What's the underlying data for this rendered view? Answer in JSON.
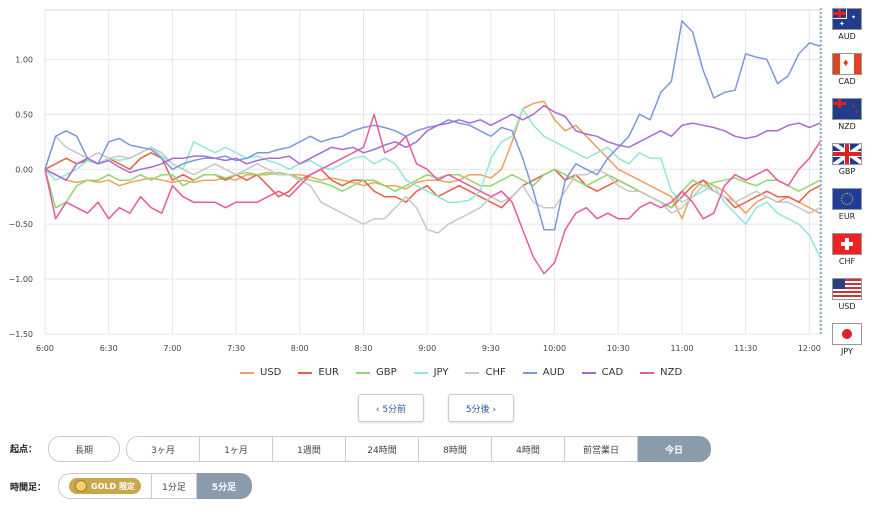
{
  "chart_data": {
    "type": "line",
    "x": [
      "6:00",
      "6:05",
      "6:10",
      "6:15",
      "6:20",
      "6:25",
      "6:30",
      "6:35",
      "6:40",
      "6:45",
      "6:50",
      "6:55",
      "7:00",
      "7:05",
      "7:10",
      "7:15",
      "7:20",
      "7:25",
      "7:30",
      "7:35",
      "7:40",
      "7:45",
      "7:50",
      "7:55",
      "8:00",
      "8:05",
      "8:10",
      "8:15",
      "8:20",
      "8:25",
      "8:30",
      "8:35",
      "8:40",
      "8:45",
      "8:50",
      "8:55",
      "9:00",
      "9:05",
      "9:10",
      "9:15",
      "9:20",
      "9:25",
      "9:30",
      "9:35",
      "9:40",
      "9:45",
      "9:50",
      "9:55",
      "10:00",
      "10:05",
      "10:10",
      "10:15",
      "10:20",
      "10:25",
      "10:30",
      "10:35",
      "10:40",
      "10:45",
      "10:50",
      "10:55",
      "11:00",
      "11:05",
      "11:10",
      "11:15",
      "11:20",
      "11:25",
      "11:30",
      "11:35",
      "11:40",
      "11:45",
      "11:50",
      "11:55",
      "12:00",
      "12:05"
    ],
    "x_ticks": [
      "6:00",
      "6:30",
      "7:00",
      "7:30",
      "8:00",
      "8:30",
      "9:00",
      "9:30",
      "10:00",
      "10:30",
      "11:00",
      "11:30",
      "12:00"
    ],
    "y_ticks": [
      "1.00",
      "0.50",
      "0.00",
      "−0.50",
      "−1.00",
      "−1.50"
    ],
    "ylim": [
      -1.5,
      1.45
    ],
    "grid": true,
    "legend_position": "bottom",
    "series": [
      {
        "name": "USD",
        "color": "#f0a060",
        "values": [
          0,
          -0.05,
          -0.1,
          -0.12,
          -0.1,
          -0.12,
          -0.1,
          -0.15,
          -0.12,
          -0.1,
          -0.08,
          -0.1,
          -0.12,
          -0.1,
          -0.12,
          -0.1,
          -0.1,
          -0.08,
          -0.1,
          -0.05,
          -0.05,
          -0.03,
          -0.05,
          -0.05,
          -0.05,
          -0.07,
          -0.1,
          -0.08,
          -0.1,
          -0.12,
          -0.15,
          -0.12,
          -0.15,
          -0.15,
          -0.18,
          -0.12,
          -0.1,
          -0.1,
          -0.12,
          -0.1,
          -0.05,
          -0.05,
          -0.08,
          0.0,
          0.25,
          0.55,
          0.6,
          0.62,
          0.45,
          0.35,
          0.4,
          0.3,
          0.2,
          0.1,
          0.0,
          -0.05,
          -0.1,
          -0.15,
          -0.2,
          -0.25,
          -0.45,
          -0.2,
          -0.1,
          -0.15,
          -0.2,
          -0.3,
          -0.4,
          -0.3,
          -0.25,
          -0.3,
          -0.25,
          -0.3,
          -0.35,
          -0.4
        ]
      },
      {
        "name": "EUR",
        "color": "#e8604c",
        "values": [
          0,
          0.05,
          0.1,
          0.05,
          0.08,
          0.05,
          0.1,
          0.05,
          0.0,
          0.1,
          0.15,
          0.1,
          -0.1,
          -0.05,
          -0.1,
          -0.05,
          -0.05,
          -0.1,
          -0.05,
          -0.1,
          -0.05,
          -0.15,
          -0.25,
          -0.2,
          -0.1,
          -0.05,
          0.0,
          -0.1,
          -0.15,
          -0.1,
          -0.1,
          -0.2,
          -0.25,
          -0.25,
          -0.3,
          -0.2,
          -0.15,
          -0.25,
          -0.2,
          -0.15,
          -0.2,
          -0.25,
          -0.3,
          -0.35,
          -0.25,
          -0.15,
          -0.1,
          -0.05,
          0.0,
          -0.1,
          -0.05,
          -0.15,
          -0.2,
          -0.15,
          -0.1,
          -0.15,
          -0.2,
          -0.25,
          -0.3,
          -0.35,
          -0.25,
          -0.15,
          -0.1,
          -0.2,
          -0.25,
          -0.35,
          -0.3,
          -0.25,
          -0.2,
          -0.25,
          -0.25,
          -0.3,
          -0.2,
          -0.15
        ]
      },
      {
        "name": "GBP",
        "color": "#90d870",
        "values": [
          0,
          -0.35,
          -0.3,
          -0.15,
          -0.1,
          -0.1,
          -0.05,
          -0.1,
          -0.1,
          -0.05,
          -0.1,
          -0.05,
          -0.05,
          -0.15,
          -0.1,
          -0.05,
          -0.05,
          -0.08,
          -0.05,
          -0.03,
          -0.05,
          -0.05,
          -0.03,
          -0.05,
          -0.08,
          -0.1,
          -0.12,
          -0.15,
          -0.2,
          -0.15,
          -0.1,
          -0.1,
          -0.15,
          -0.2,
          -0.15,
          -0.1,
          -0.05,
          -0.08,
          -0.05,
          -0.05,
          -0.1,
          -0.15,
          -0.15,
          -0.1,
          -0.05,
          -0.1,
          -0.15,
          -0.05,
          0.0,
          -0.05,
          -0.1,
          -0.15,
          -0.1,
          -0.05,
          -0.1,
          -0.15,
          -0.2,
          -0.25,
          -0.3,
          -0.35,
          -0.2,
          -0.1,
          -0.15,
          -0.12,
          -0.1,
          -0.08,
          -0.12,
          -0.15,
          -0.1,
          -0.1,
          -0.15,
          -0.2,
          -0.15,
          -0.1
        ]
      },
      {
        "name": "JPY",
        "color": "#90e8d8",
        "values": [
          0,
          -0.1,
          -0.05,
          0.0,
          0.08,
          0.05,
          0.1,
          0.08,
          0.1,
          0.15,
          0.2,
          0.12,
          0.05,
          0.0,
          0.25,
          0.2,
          0.15,
          0.2,
          0.15,
          0.1,
          0.12,
          0.08,
          0.05,
          0.0,
          0.05,
          0.08,
          0.02,
          0.0,
          0.05,
          0.1,
          0.12,
          0.05,
          0.1,
          0.05,
          -0.1,
          -0.15,
          -0.2,
          -0.25,
          -0.3,
          -0.3,
          -0.28,
          -0.2,
          0.1,
          0.25,
          0.3,
          0.55,
          0.4,
          0.3,
          0.25,
          0.2,
          0.15,
          0.1,
          0.15,
          0.2,
          0.1,
          0.05,
          0.15,
          0.1,
          0.1,
          -0.2,
          -0.3,
          -0.25,
          -0.2,
          -0.15,
          -0.3,
          -0.4,
          -0.5,
          -0.35,
          -0.3,
          -0.4,
          -0.45,
          -0.5,
          -0.6,
          -0.8
        ]
      },
      {
        "name": "CHF",
        "color": "#c8c8c8",
        "values": [
          0,
          0.3,
          0.2,
          0.15,
          0.1,
          0.15,
          0.1,
          0.12,
          0.1,
          0.15,
          0.2,
          0.15,
          0.05,
          0.0,
          -0.05,
          0.0,
          0.05,
          0.0,
          -0.05,
          0.0,
          0.05,
          0.0,
          -0.05,
          -0.05,
          -0.1,
          -0.15,
          -0.3,
          -0.35,
          -0.4,
          -0.45,
          -0.5,
          -0.45,
          -0.45,
          -0.35,
          -0.25,
          -0.35,
          -0.55,
          -0.58,
          -0.5,
          -0.45,
          -0.4,
          -0.35,
          -0.25,
          -0.3,
          -0.25,
          -0.15,
          -0.3,
          -0.35,
          -0.35,
          -0.2,
          -0.05,
          -0.05,
          0.0,
          -0.05,
          -0.15,
          -0.2,
          -0.2,
          -0.25,
          -0.3,
          -0.4,
          -0.35,
          -0.25,
          -0.15,
          -0.2,
          -0.25,
          -0.3,
          -0.25,
          -0.2,
          -0.25,
          -0.3,
          -0.3,
          -0.35,
          -0.4,
          -0.35
        ]
      },
      {
        "name": "AUD",
        "color": "#7b98dc",
        "values": [
          0,
          0.3,
          0.35,
          0.3,
          0.1,
          0.05,
          0.25,
          0.28,
          0.22,
          0.2,
          0.18,
          0.1,
          0.0,
          0.05,
          0.08,
          0.1,
          0.1,
          0.12,
          0.08,
          0.1,
          0.15,
          0.15,
          0.18,
          0.2,
          0.25,
          0.3,
          0.25,
          0.28,
          0.3,
          0.35,
          0.38,
          0.4,
          0.38,
          0.35,
          0.3,
          0.35,
          0.38,
          0.4,
          0.45,
          0.42,
          0.4,
          0.35,
          0.3,
          0.38,
          0.35,
          0.1,
          -0.2,
          -0.55,
          -0.55,
          -0.1,
          0.05,
          0.0,
          -0.05,
          0.1,
          0.2,
          0.3,
          0.5,
          0.45,
          0.7,
          0.8,
          1.35,
          1.25,
          0.9,
          0.65,
          0.7,
          0.72,
          1.05,
          1.02,
          1.0,
          0.78,
          0.85,
          1.05,
          1.15,
          1.12
        ]
      },
      {
        "name": "CAD",
        "color": "#a86cd0",
        "values": [
          0,
          -0.05,
          -0.1,
          0.05,
          0.1,
          0.05,
          0.08,
          0.02,
          -0.03,
          0.0,
          0.02,
          0.05,
          0.1,
          0.1,
          0.12,
          0.12,
          0.1,
          0.08,
          0.1,
          0.05,
          0.08,
          0.1,
          0.1,
          0.12,
          0.05,
          0.1,
          0.15,
          0.2,
          0.18,
          0.2,
          0.15,
          0.18,
          0.22,
          0.25,
          0.2,
          0.25,
          0.35,
          0.4,
          0.42,
          0.45,
          0.42,
          0.45,
          0.4,
          0.45,
          0.5,
          0.45,
          0.5,
          0.58,
          0.52,
          0.48,
          0.35,
          0.32,
          0.3,
          0.25,
          0.22,
          0.2,
          0.25,
          0.3,
          0.35,
          0.3,
          0.4,
          0.42,
          0.4,
          0.38,
          0.35,
          0.3,
          0.28,
          0.3,
          0.35,
          0.35,
          0.4,
          0.42,
          0.38,
          0.42
        ]
      },
      {
        "name": "NZD",
        "color": "#e85aa0",
        "values": [
          0,
          -0.45,
          -0.3,
          -0.35,
          -0.4,
          -0.3,
          -0.45,
          -0.35,
          -0.4,
          -0.25,
          -0.35,
          -0.4,
          -0.15,
          -0.25,
          -0.3,
          -0.3,
          -0.3,
          -0.35,
          -0.3,
          -0.3,
          -0.3,
          -0.25,
          -0.2,
          -0.25,
          -0.15,
          -0.05,
          0.0,
          0.05,
          0.1,
          0.15,
          0.2,
          0.5,
          0.15,
          0.2,
          0.3,
          0.05,
          0.0,
          -0.1,
          -0.05,
          -0.1,
          -0.15,
          -0.2,
          -0.25,
          -0.2,
          -0.3,
          -0.55,
          -0.8,
          -0.95,
          -0.85,
          -0.55,
          -0.4,
          -0.35,
          -0.45,
          -0.4,
          -0.45,
          -0.45,
          -0.35,
          -0.3,
          -0.35,
          -0.3,
          -0.2,
          -0.3,
          -0.45,
          -0.4,
          -0.15,
          -0.05,
          -0.1,
          -0.05,
          0.0,
          -0.1,
          -0.15,
          0.0,
          0.1,
          0.25
        ]
      }
    ]
  },
  "legend": [
    "USD",
    "EUR",
    "GBP",
    "JPY",
    "CHF",
    "AUD",
    "CAD",
    "NZD"
  ],
  "flags": [
    {
      "code": "AUD",
      "icon": "australia-flag"
    },
    {
      "code": "CAD",
      "icon": "canada-flag"
    },
    {
      "code": "NZD",
      "icon": "new-zealand-flag"
    },
    {
      "code": "GBP",
      "icon": "uk-flag"
    },
    {
      "code": "EUR",
      "icon": "eu-flag"
    },
    {
      "code": "CHF",
      "icon": "swiss-flag"
    },
    {
      "code": "USD",
      "icon": "us-flag"
    },
    {
      "code": "JPY",
      "icon": "japan-flag"
    }
  ],
  "nav": {
    "prev": "‹ 5分前",
    "next": "5分後 ›"
  },
  "range": {
    "label": "起点：",
    "long": "長期",
    "options": [
      "3ヶ月",
      "1ヶ月",
      "1週間",
      "24時間",
      "8時間",
      "4時間",
      "前営業日",
      "今日"
    ],
    "selected": "今日"
  },
  "interval": {
    "label": "時間足：",
    "gold": "GOLD 限定",
    "options": [
      "1分足",
      "5分足"
    ],
    "selected": "5分足"
  }
}
